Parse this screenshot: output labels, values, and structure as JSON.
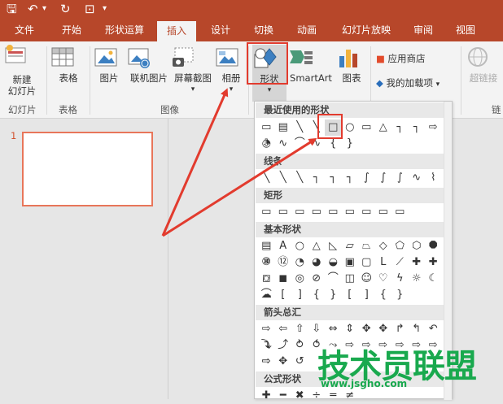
{
  "titlebar": {
    "save": "🖫",
    "undo": "↶",
    "dropdown": "▾"
  },
  "tabs": [
    "文件",
    "开始",
    "形状运算",
    "插入",
    "设计",
    "切换",
    "动画",
    "幻灯片放映",
    "审阅",
    "视图"
  ],
  "ribbon": {
    "new_slide": "新建\n幻灯片",
    "table": "表格",
    "picture": "图片",
    "online_picture": "联机图片",
    "screenshot": "屏幕截图",
    "album": "相册",
    "shapes": "形状",
    "smartart": "SmartArt",
    "chart": "图表",
    "store": "应用商店",
    "my_addins": "我的加载项",
    "hyperlink": "超链接",
    "groups": {
      "slides": "幻灯片",
      "tables": "表格",
      "images": "图像",
      "links": "链"
    }
  },
  "slide_pane": {
    "slide_number": "1"
  },
  "shapes_dropdown": {
    "sections": [
      "最近使用的形状",
      "线条",
      "矩形",
      "基本形状",
      "箭头总汇",
      "公式形状"
    ],
    "recent_row1": [
      "▭",
      "▤",
      "╲",
      "╲",
      "□",
      "○",
      "▭",
      "△",
      "┐",
      "┐",
      "⇨",
      "⇩"
    ],
    "recent_row2": [
      "◔",
      "∿",
      "⌒",
      "∿",
      "{",
      "}"
    ],
    "lines_row": [
      "╲",
      "╲",
      "╲",
      "┐",
      "┐",
      "┐",
      "∫",
      "∫",
      "∫",
      "∿",
      "⌇"
    ],
    "rect_row": [
      "▭",
      "▭",
      "▭",
      "▭",
      "▭",
      "▭",
      "▭",
      "▭",
      "▭"
    ],
    "basic_row1": [
      "▤",
      "A",
      "○",
      "△",
      "◺",
      "▱",
      "⏢",
      "◇",
      "⬠",
      "⬡",
      "⯃",
      "⑧"
    ],
    "basic_row2": [
      "⑩",
      "⑫",
      "◔",
      "◕",
      "◒",
      "▣",
      "▢",
      "L",
      "⟋",
      "✚",
      "✚",
      "⌭"
    ],
    "basic_row3": [
      "◻",
      "◼",
      "◎",
      "⊘",
      "⌒",
      "◫",
      "☺",
      "♡",
      "ϟ",
      "☼",
      "☾",
      "☁"
    ],
    "basic_row4": [
      "⌒",
      "[",
      "]",
      "{",
      "}",
      "[",
      "]",
      "{",
      "}"
    ],
    "arrow_row1": [
      "⇨",
      "⇦",
      "⇧",
      "⇩",
      "⇔",
      "⇕",
      "✥",
      "✥",
      "↱",
      "↰",
      "↶",
      "↴"
    ],
    "arrow_row2": [
      "⤵",
      "⤴",
      "⥁",
      "⥀",
      "⤳",
      "⇨",
      "⇨",
      "⇨",
      "⇨",
      "⇨",
      "⇨",
      "⇨"
    ],
    "arrow_row3": [
      "⇨",
      "✥",
      "↺"
    ],
    "formula_row": [
      "✚",
      "━",
      "✖",
      "÷",
      "═",
      "≠"
    ]
  },
  "watermark": {
    "title": "技术员联盟",
    "url": "www.jsgho.com"
  },
  "colors": {
    "accent": "#b7472a",
    "highlight": "#e23b2e",
    "watermark": "#19a94e"
  }
}
